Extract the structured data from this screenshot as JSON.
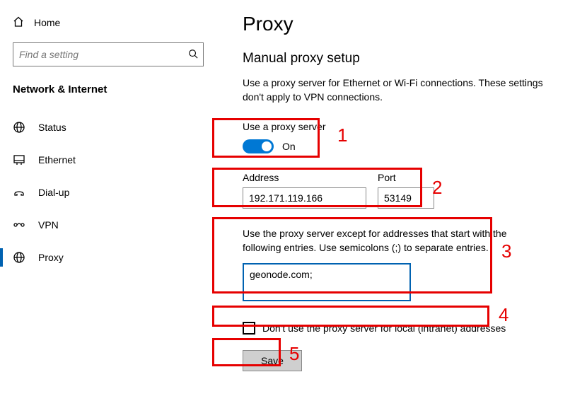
{
  "sidebar": {
    "home_label": "Home",
    "search_placeholder": "Find a setting",
    "section_title": "Network & Internet",
    "items": [
      {
        "label": "Status",
        "icon": "status-icon",
        "active": false
      },
      {
        "label": "Ethernet",
        "icon": "ethernet-icon",
        "active": false
      },
      {
        "label": "Dial-up",
        "icon": "dialup-icon",
        "active": false
      },
      {
        "label": "VPN",
        "icon": "vpn-icon",
        "active": false
      },
      {
        "label": "Proxy",
        "icon": "globe-icon",
        "active": true
      }
    ]
  },
  "main": {
    "page_title": "Proxy",
    "subheading": "Manual proxy setup",
    "description": "Use a proxy server for Ethernet or Wi-Fi connections. These settings don't apply to VPN connections.",
    "use_proxy_label": "Use a proxy server",
    "toggle_state": "On",
    "address_label": "Address",
    "address_value": "192.171.119.166",
    "port_label": "Port",
    "port_value": "53149",
    "exceptions_text": "Use the proxy server except for addresses that start with the following entries. Use semicolons (;) to separate entries.",
    "exceptions_value": "geonode.com;",
    "local_bypass_label": "Don't use the proxy server for local (intranet) addresses",
    "save_label": "Save"
  },
  "annotations": {
    "n1": "1",
    "n2": "2",
    "n3": "3",
    "n4": "4",
    "n5": "5"
  }
}
